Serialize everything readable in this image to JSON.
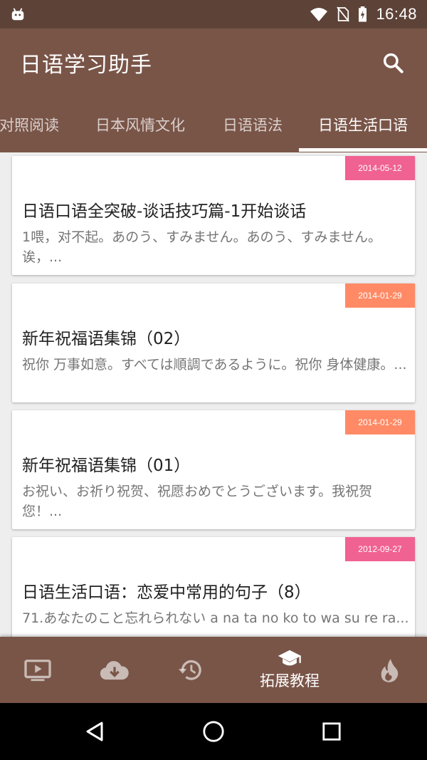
{
  "status_bar": {
    "time": "16:48"
  },
  "app_bar": {
    "title": "日语学习助手"
  },
  "tabs": [
    {
      "label": "对照阅读"
    },
    {
      "label": "日本风情文化"
    },
    {
      "label": "日语语法"
    },
    {
      "label": "日语生活口语",
      "active": true
    }
  ],
  "articles": [
    {
      "date": "2014-05-12",
      "badge_color": "#f06292",
      "title": "日语口语全突破-谈话技巧篇-1开始谈话",
      "summary": "1喂，对不起。あのう、すみません。あのう、すみません。诶，..."
    },
    {
      "date": "2014-01-29",
      "badge_color": "#ff8a65",
      "title": "新年祝福语集锦（02）",
      "summary": "祝你 万事如意。すべては順調であるように。祝你 身体健康。..."
    },
    {
      "date": "2014-01-29",
      "badge_color": "#ff8a65",
      "title": "新年祝福语集锦（01）",
      "summary": "お祝い、お祈り祝贺、祝愿おめでとうございます。我祝贺您！..."
    },
    {
      "date": "2012-09-27",
      "badge_color": "#f06292",
      "title": "日语生活口语：恋爱中常用的句子（8）",
      "summary": "71.あなたのこと忘れられない a na ta no ko to wa su re ra..."
    }
  ],
  "bottom_nav": {
    "items": [
      {
        "icon": "video-icon"
      },
      {
        "icon": "cloud-download-icon"
      },
      {
        "icon": "history-icon"
      },
      {
        "icon": "school-icon",
        "label": "拓展教程",
        "active": true
      },
      {
        "icon": "flame-icon"
      }
    ]
  }
}
